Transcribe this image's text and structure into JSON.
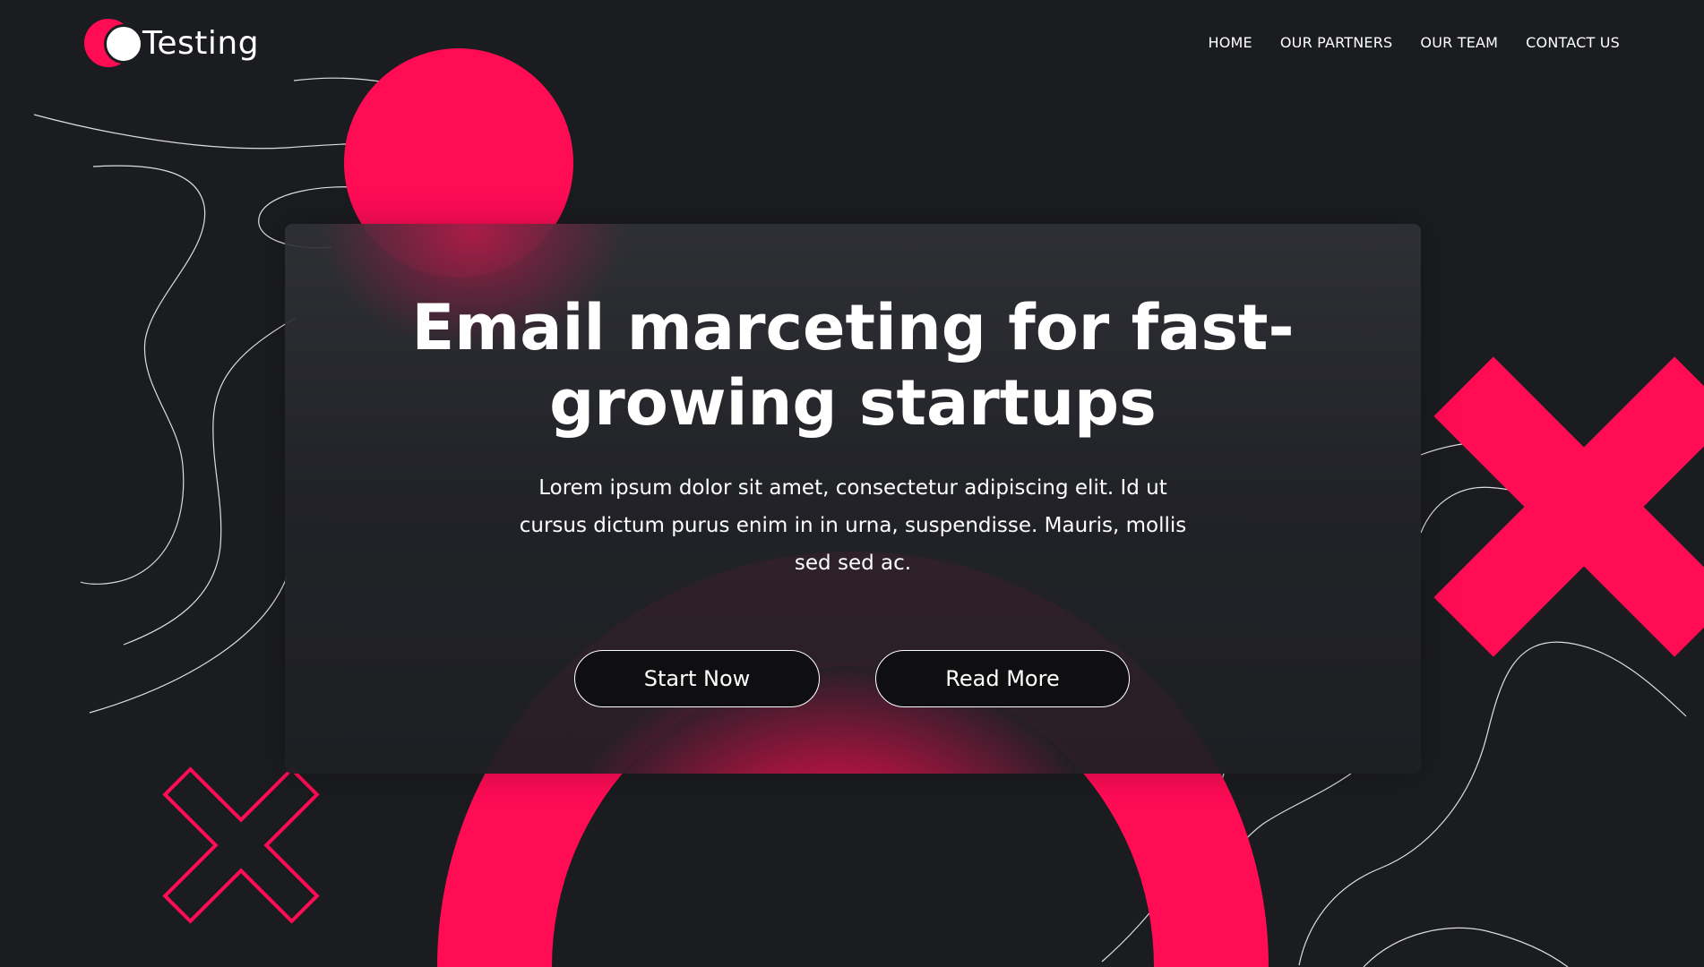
{
  "header": {
    "brand": "Testing",
    "nav": [
      "HOME",
      "OUR PARTNERS",
      "OUR TEAM",
      "CONTACT US"
    ]
  },
  "hero": {
    "title": "Email marceting for fast-growing startups",
    "description": "Lorem ipsum dolor sit amet, consectetur adipiscing elit. Id ut cursus dictum purus enim in in urna, suspendisse. Mauris, mollis sed sed ac.",
    "buttons": {
      "primary": "Start Now",
      "secondary": "Read More"
    }
  },
  "colors": {
    "accent": "#ff0c55",
    "background": "#1b1c20",
    "text": "#ffffff"
  },
  "icons": [
    "logo-circle-icon",
    "x-shape-icon",
    "outlined-x-shape-icon"
  ]
}
